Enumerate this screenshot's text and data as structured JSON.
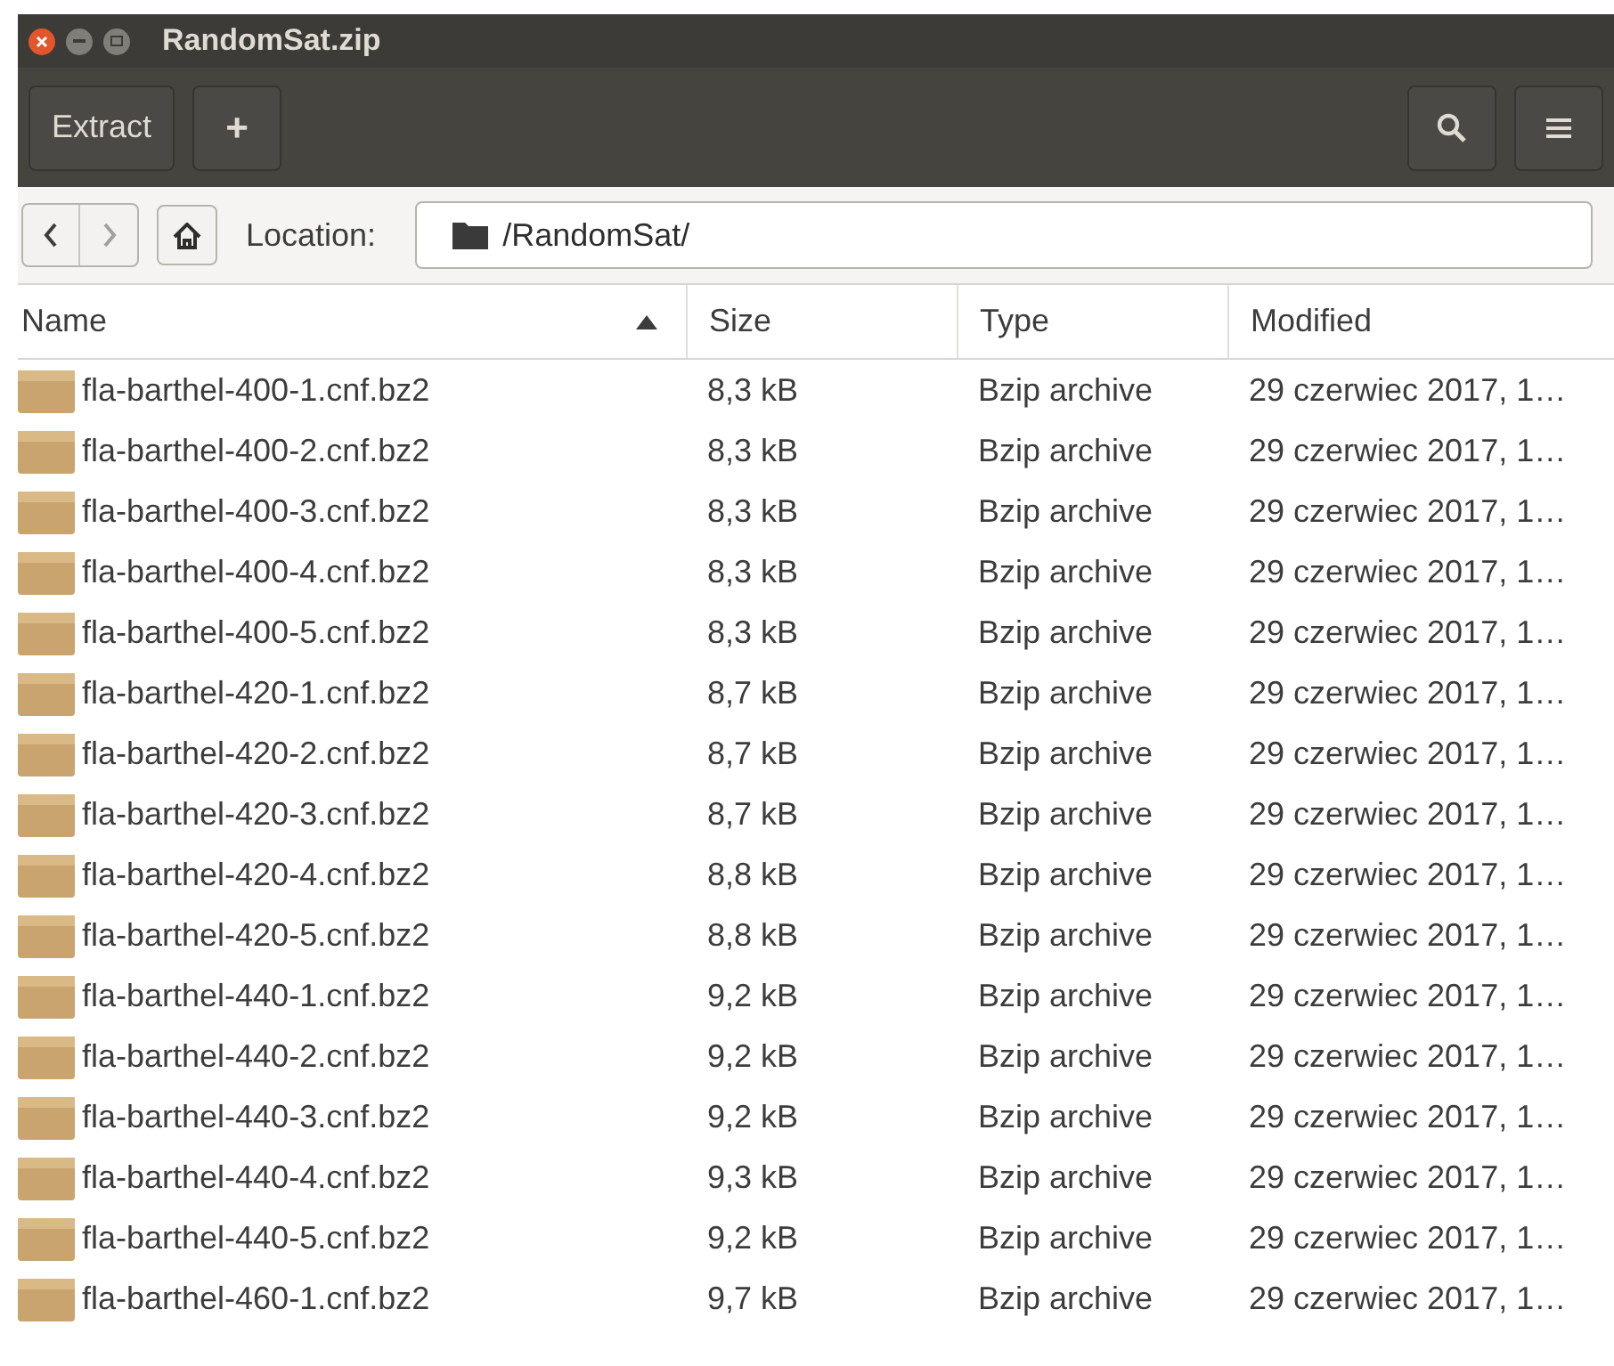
{
  "window": {
    "title": "RandomSat.zip"
  },
  "toolbar": {
    "extract": "Extract",
    "add": "+"
  },
  "location": {
    "label": "Location:",
    "path": "/RandomSat/"
  },
  "table": {
    "columns": [
      {
        "label": "Name",
        "sorted": true
      },
      {
        "label": "Size",
        "sorted": false
      },
      {
        "label": "Type",
        "sorted": false
      },
      {
        "label": "Modified",
        "sorted": false
      }
    ],
    "rows": [
      {
        "name": "fla-barthel-400-1.cnf.bz2",
        "size": "8,3 kB",
        "type": "Bzip archive",
        "modified": "29 czerwiec 2017, 1…"
      },
      {
        "name": "fla-barthel-400-2.cnf.bz2",
        "size": "8,3 kB",
        "type": "Bzip archive",
        "modified": "29 czerwiec 2017, 1…"
      },
      {
        "name": "fla-barthel-400-3.cnf.bz2",
        "size": "8,3 kB",
        "type": "Bzip archive",
        "modified": "29 czerwiec 2017, 1…"
      },
      {
        "name": "fla-barthel-400-4.cnf.bz2",
        "size": "8,3 kB",
        "type": "Bzip archive",
        "modified": "29 czerwiec 2017, 1…"
      },
      {
        "name": "fla-barthel-400-5.cnf.bz2",
        "size": "8,3 kB",
        "type": "Bzip archive",
        "modified": "29 czerwiec 2017, 1…"
      },
      {
        "name": "fla-barthel-420-1.cnf.bz2",
        "size": "8,7 kB",
        "type": "Bzip archive",
        "modified": "29 czerwiec 2017, 1…"
      },
      {
        "name": "fla-barthel-420-2.cnf.bz2",
        "size": "8,7 kB",
        "type": "Bzip archive",
        "modified": "29 czerwiec 2017, 1…"
      },
      {
        "name": "fla-barthel-420-3.cnf.bz2",
        "size": "8,7 kB",
        "type": "Bzip archive",
        "modified": "29 czerwiec 2017, 1…"
      },
      {
        "name": "fla-barthel-420-4.cnf.bz2",
        "size": "8,8 kB",
        "type": "Bzip archive",
        "modified": "29 czerwiec 2017, 1…"
      },
      {
        "name": "fla-barthel-420-5.cnf.bz2",
        "size": "8,8 kB",
        "type": "Bzip archive",
        "modified": "29 czerwiec 2017, 1…"
      },
      {
        "name": "fla-barthel-440-1.cnf.bz2",
        "size": "9,2 kB",
        "type": "Bzip archive",
        "modified": "29 czerwiec 2017, 1…"
      },
      {
        "name": "fla-barthel-440-2.cnf.bz2",
        "size": "9,2 kB",
        "type": "Bzip archive",
        "modified": "29 czerwiec 2017, 1…"
      },
      {
        "name": "fla-barthel-440-3.cnf.bz2",
        "size": "9,2 kB",
        "type": "Bzip archive",
        "modified": "29 czerwiec 2017, 1…"
      },
      {
        "name": "fla-barthel-440-4.cnf.bz2",
        "size": "9,3 kB",
        "type": "Bzip archive",
        "modified": "29 czerwiec 2017, 1…"
      },
      {
        "name": "fla-barthel-440-5.cnf.bz2",
        "size": "9,2 kB",
        "type": "Bzip archive",
        "modified": "29 czerwiec 2017, 1…"
      },
      {
        "name": "fla-barthel-460-1.cnf.bz2",
        "size": "9,7 kB",
        "type": "Bzip archive",
        "modified": "29 czerwiec 2017, 1…"
      }
    ]
  }
}
